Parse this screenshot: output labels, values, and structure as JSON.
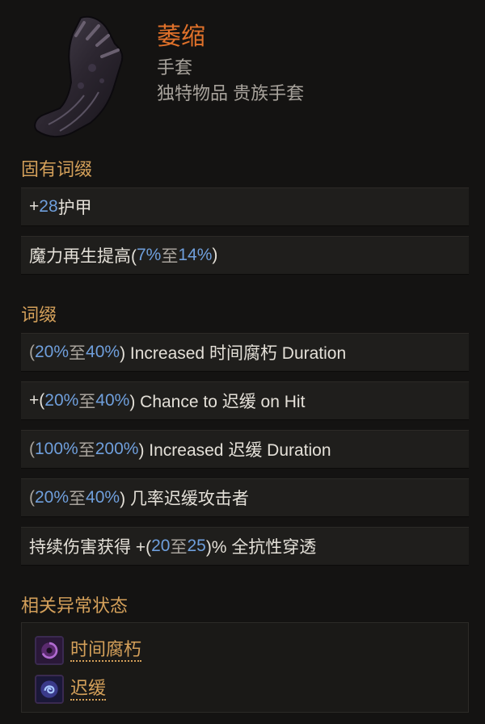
{
  "item": {
    "name": "萎缩",
    "type": "手套",
    "rarity_line": "独特物品 贵族手套",
    "icon": "gauntlet-icon"
  },
  "implicit": {
    "title": "固有词缀",
    "rows": [
      {
        "p1": "+",
        "n1": "28",
        "p2": " 护甲"
      },
      {
        "p1": "魔力再生提高(",
        "n1": "7%",
        "g1": " 至 ",
        "n2": "14%",
        "p2": ")"
      }
    ]
  },
  "affixes": {
    "title": "词缀",
    "rows": [
      {
        "p1": "(",
        "n1": "20%",
        "g1": " 至 ",
        "n2": "40%",
        "p2": ") Increased 时间腐朽 Duration"
      },
      {
        "p1": "+(",
        "n1": "20%",
        "g1": " 至 ",
        "n2": "40%",
        "p2": ") Chance to 迟缓 on Hit"
      },
      {
        "p1": "(",
        "n1": "100%",
        "g1": " 至 ",
        "n2": "200%",
        "p2": ") Increased 迟缓 Duration"
      },
      {
        "p1": "(",
        "n1": "20%",
        "g1": " 至 ",
        "n2": "40%",
        "p2": ") 几率迟缓攻击者"
      },
      {
        "p1": "持续伤害获得 +(",
        "n1": "20",
        "g1": " 至 ",
        "n2": "25",
        "p2": ")% 全抗性穿透"
      }
    ]
  },
  "status": {
    "title": "相关异常状态",
    "items": [
      {
        "label": "时间腐朽",
        "icon": "time-rot-icon"
      },
      {
        "label": "迟缓",
        "icon": "slow-icon"
      }
    ]
  },
  "colors": {
    "item_name": "#e0712a",
    "section_title": "#d4a05a",
    "number": "#6f9fdc",
    "link": "#d4a05a"
  }
}
